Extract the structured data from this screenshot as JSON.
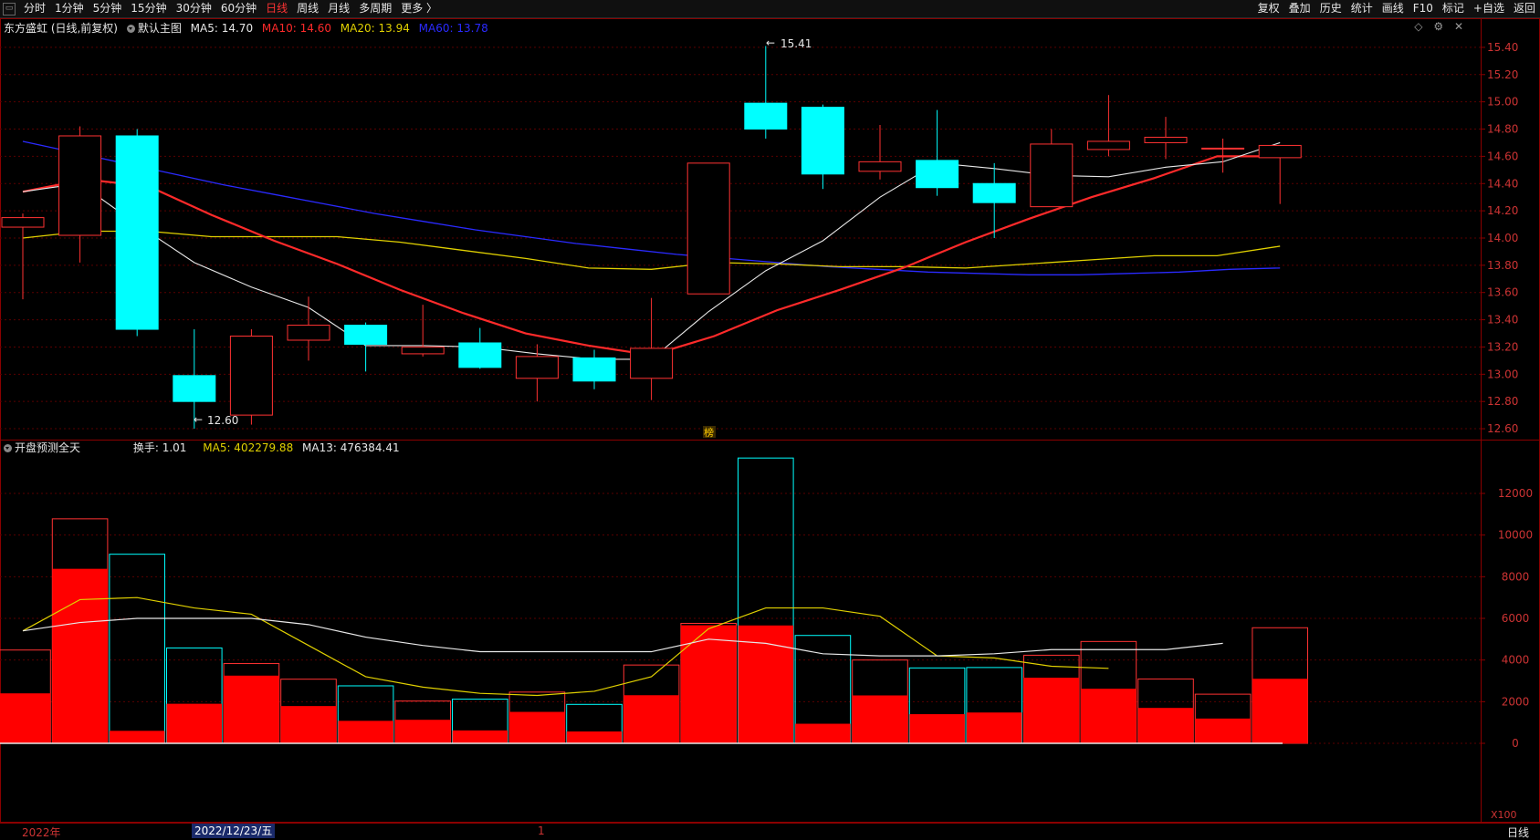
{
  "toolbar": {
    "periods": [
      "分时",
      "1分钟",
      "5分钟",
      "15分钟",
      "30分钟",
      "60分钟",
      "日线",
      "周线",
      "月线",
      "多周期",
      "更多 〉"
    ],
    "active_period": "日线",
    "right_buttons": [
      "复权",
      "叠加",
      "历史",
      "统计",
      "画线",
      "F10",
      "标记",
      "+自选",
      "返回"
    ]
  },
  "main_legend": {
    "title": "东方盛虹 (日线,前复权)",
    "template": "默认主图",
    "ma5": "MA5: 14.70",
    "ma10": "MA10: 14.60",
    "ma20": "MA20: 13.94",
    "ma60": "MA60: 13.78"
  },
  "vol_legend": {
    "title": "开盘预测全天",
    "turnover": "换手: 1.01",
    "ma5": "MA5: 402279.88",
    "ma13": "MA13: 476384.41"
  },
  "bottom": {
    "year": "2022年",
    "cursor_date": "2022/12/23/五",
    "tick": "1",
    "period": "日线"
  },
  "annotations": {
    "high": "15.41",
    "low": "12.60",
    "marker": "榜",
    "scale": "X100"
  },
  "colors": {
    "up": "#ff3232",
    "down": "#00ffff",
    "ma5": "#e8e8e8",
    "ma10": "#ff2a2a",
    "ma20": "#e0d000",
    "ma60": "#2a2aff",
    "grid": "#5a0000"
  },
  "chart_data": [
    {
      "type": "candlestick",
      "price_axis": [
        "15.40",
        "15.20",
        "15.00",
        "14.80",
        "14.60",
        "14.40",
        "14.20",
        "14.00",
        "13.80",
        "13.60",
        "13.40",
        "13.20",
        "13.00",
        "12.80",
        "12.60"
      ],
      "ylim": [
        12.52,
        15.52
      ],
      "candles": [
        {
          "o": 14.08,
          "h": 14.18,
          "l": 13.55,
          "c": 14.15
        },
        {
          "o": 14.02,
          "h": 14.82,
          "l": 13.82,
          "c": 14.75
        },
        {
          "o": 14.75,
          "h": 14.8,
          "l": 13.28,
          "c": 13.33
        },
        {
          "o": 12.99,
          "h": 13.33,
          "l": 12.6,
          "c": 12.8
        },
        {
          "o": 12.7,
          "h": 13.33,
          "l": 12.63,
          "c": 13.28
        },
        {
          "o": 13.25,
          "h": 13.57,
          "l": 13.1,
          "c": 13.36
        },
        {
          "o": 13.36,
          "h": 13.38,
          "l": 13.02,
          "c": 13.22
        },
        {
          "o": 13.15,
          "h": 13.51,
          "l": 13.13,
          "c": 13.2
        },
        {
          "o": 13.23,
          "h": 13.34,
          "l": 13.04,
          "c": 13.05
        },
        {
          "o": 12.97,
          "h": 13.22,
          "l": 12.8,
          "c": 13.13
        },
        {
          "o": 13.12,
          "h": 13.18,
          "l": 12.89,
          "c": 12.95
        },
        {
          "o": 12.97,
          "h": 13.56,
          "l": 12.81,
          "c": 13.19
        },
        {
          "o": 13.59,
          "h": 14.55,
          "l": 13.59,
          "c": 14.55
        },
        {
          "o": 14.99,
          "h": 15.41,
          "l": 14.73,
          "c": 14.8
        },
        {
          "o": 14.96,
          "h": 14.98,
          "l": 14.36,
          "c": 14.47
        },
        {
          "o": 14.49,
          "h": 14.83,
          "l": 14.43,
          "c": 14.56
        },
        {
          "o": 14.57,
          "h": 14.94,
          "l": 14.31,
          "c": 14.37
        },
        {
          "o": 14.4,
          "h": 14.55,
          "l": 14.0,
          "c": 14.26
        },
        {
          "o": 14.23,
          "h": 14.8,
          "l": 14.23,
          "c": 14.69
        },
        {
          "o": 14.65,
          "h": 15.05,
          "l": 14.6,
          "c": 14.71
        },
        {
          "o": 14.7,
          "h": 14.89,
          "l": 14.58,
          "c": 14.74
        },
        {
          "o": 14.66,
          "h": 14.73,
          "l": 14.48,
          "c": 14.66
        },
        {
          "o": 14.59,
          "h": 14.68,
          "l": 14.25,
          "c": 14.68
        }
      ],
      "ma5": [
        14.34,
        14.4,
        14.1,
        13.82,
        13.64,
        13.49,
        13.21,
        13.21,
        13.2,
        13.15,
        13.11,
        13.11,
        13.46,
        13.76,
        13.98,
        14.3,
        14.55,
        14.51,
        14.46,
        14.45,
        14.52,
        14.56,
        14.7
      ],
      "ma10": [
        14.34,
        14.43,
        14.38,
        14.17,
        13.98,
        13.81,
        13.62,
        13.45,
        13.3,
        13.21,
        13.14,
        13.28,
        13.47,
        13.62,
        13.78,
        13.97,
        14.14,
        14.3,
        14.44,
        14.6,
        14.6
      ],
      "ma20": [
        14.0,
        14.05,
        14.05,
        14.01,
        14.01,
        14.01,
        13.97,
        13.91,
        13.85,
        13.78,
        13.77,
        13.82,
        13.81,
        13.79,
        13.79,
        13.78,
        13.81,
        13.84,
        13.87,
        13.87,
        13.94
      ],
      "ma60": [
        14.71,
        14.63,
        14.55,
        14.47,
        14.39,
        14.32,
        14.25,
        14.18,
        14.12,
        14.06,
        14.01,
        13.96,
        13.92,
        13.88,
        13.85,
        13.82,
        13.79,
        13.77,
        13.75,
        13.74,
        13.73,
        13.73,
        13.74,
        13.75,
        13.77,
        13.78
      ]
    },
    {
      "type": "bar",
      "unit": "X100",
      "axis": [
        "12000",
        "10000",
        "8000",
        "6000",
        "4000",
        "2000",
        "0"
      ],
      "ylim": [
        0,
        14000
      ],
      "volume": [
        4480,
        10780,
        9080,
        4580,
        3830,
        3080,
        2760,
        2030,
        2120,
        2460,
        1870,
        3760,
        5760,
        13700,
        5180,
        4000,
        3620,
        3640,
        4230,
        4890,
        3090,
        2360,
        5550
      ],
      "overlay": [
        2400,
        8380,
        600,
        1900,
        3250,
        1790,
        1080,
        1130,
        620,
        1510,
        570,
        2310,
        5670,
        5660,
        940,
        2300,
        1400,
        1480,
        3150,
        2620,
        1700,
        1190,
        3100
      ],
      "ma5_line": [
        5400,
        6900,
        7000,
        6500,
        6200,
        4700,
        3200,
        2700,
        2400,
        2300,
        2500,
        3200,
        5500,
        6500,
        6500,
        6100,
        4200,
        4100,
        3700,
        3600
      ],
      "ma13_line": [
        5400,
        5800,
        6000,
        6000,
        6000,
        5700,
        5100,
        4700,
        4400,
        4400,
        4400,
        4400,
        5000,
        4800,
        4300,
        4200,
        4200,
        4300,
        4500,
        4500,
        4500,
        4800
      ]
    }
  ]
}
